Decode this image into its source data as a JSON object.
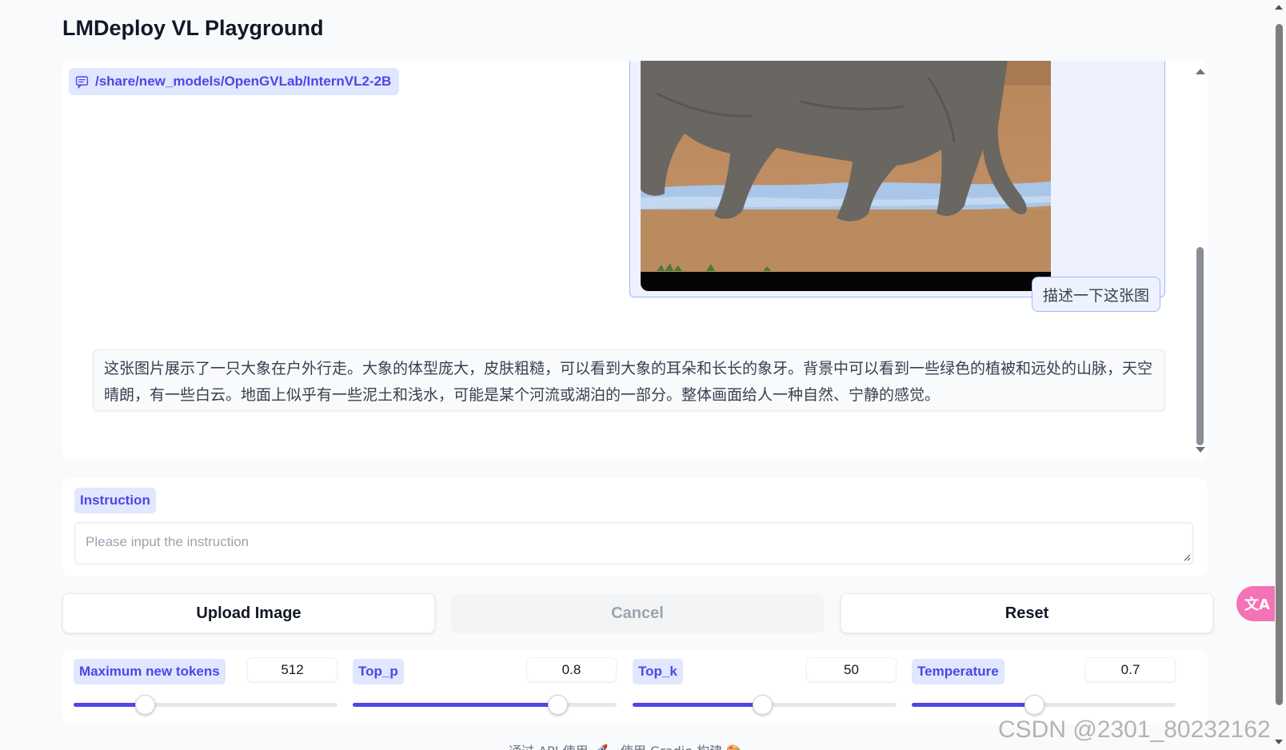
{
  "app": {
    "title": "LMDeploy VL Playground"
  },
  "chat": {
    "model_path": "/share/new_models/OpenGVLab/InternVL2-2B",
    "user_message": "描述一下这张图",
    "bot_message": "这张图片展示了一只大象在户外行走。大象的体型庞大，皮肤粗糙，可以看到大象的耳朵和长长的象牙。背景中可以看到一些绿色的植被和远处的山脉，天空晴朗，有一些白云。地面上似乎有一些泥土和浅水，可能是某个河流或湖泊的一部分。整体画面给人一种自然、宁静的感觉。"
  },
  "instruction": {
    "label": "Instruction",
    "placeholder": "Please input the instruction",
    "value": ""
  },
  "buttons": {
    "upload": "Upload Image",
    "cancel": "Cancel",
    "reset": "Reset"
  },
  "params": [
    {
      "label": "Maximum new tokens",
      "value": "512",
      "fraction": 0.27
    },
    {
      "label": "Top_p",
      "value": "0.8",
      "fraction": 0.775
    },
    {
      "label": "Top_k",
      "value": "50",
      "fraction": 0.49
    },
    {
      "label": "Temperature",
      "value": "0.7",
      "fraction": 0.465
    }
  ],
  "footer": {
    "text": "通过 API 使用 🚀 · 使用 Gradio 构建 🎨"
  },
  "watermark": "CSDN @2301_80232162",
  "colors": {
    "accent": "#4f46e5",
    "chip_bg": "#e0e7ff",
    "fab": "#f472b6"
  },
  "icons": {
    "model_badge": "chat-bubble-icon",
    "translate": "translate-icon"
  }
}
